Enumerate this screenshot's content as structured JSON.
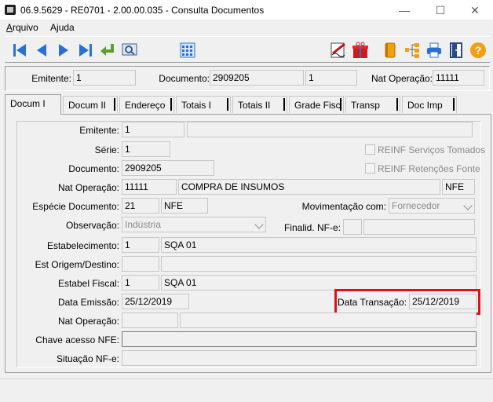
{
  "window": {
    "title": "06.9.5629 - RE0701 - 2.00.00.035 - Consulta Documentos",
    "minimize": "—",
    "maximize": "☐",
    "close": "✕"
  },
  "menu": {
    "arquivo": {
      "first": "A",
      "rest": "rquivo"
    },
    "ajuda": {
      "first": "A",
      "underline": "j",
      "rest": "uda"
    }
  },
  "toolbar": {
    "icons": [
      "first-record-icon",
      "previous-record-icon",
      "next-record-icon",
      "last-record-icon",
      "go-to-icon",
      "search-icon",
      "calendar-icon",
      "signature-icon",
      "gift-icon",
      "book-icon",
      "tree-icon",
      "print-icon",
      "exit-icon",
      "help-icon"
    ],
    "help_label": "?"
  },
  "header": {
    "emitente_label": "Emitente:",
    "emitente_value": "1",
    "documento_label": "Documento:",
    "documento_value": "2909205",
    "documento_serie": "1",
    "nat_operacao_label": "Nat Operação:",
    "nat_operacao_value": "11111"
  },
  "tabs": [
    "Docum I",
    "Docum II",
    "Endereço",
    "Totais I",
    "Totais II",
    "Grade Fisc",
    "Transp",
    "Doc Imp"
  ],
  "form": {
    "emitente": {
      "label": "Emitente:",
      "value": "1",
      "name": ""
    },
    "serie": {
      "label": "Série:",
      "value": "1"
    },
    "documento": {
      "label": "Documento:",
      "value": "2909205"
    },
    "nat_operacao": {
      "label": "Nat Operação:",
      "code": "11111",
      "desc": "COMPRA DE INSUMOS",
      "tipo": "NFE"
    },
    "especie": {
      "label": "Espécie Documento:",
      "code": "21",
      "desc": "NFE"
    },
    "movimentacao": {
      "label": "Movimentação com:",
      "value": "Fornecedor"
    },
    "observacao": {
      "label": "Observação:",
      "value": "Indústria"
    },
    "finalid": {
      "label": "Finalid. NF-e:",
      "code": "",
      "desc": ""
    },
    "reinf_servicos": {
      "label": "REINF Serviços Tomados",
      "checked": false
    },
    "reinf_retencoes": {
      "label": "REINF Retenções Fonte",
      "checked": false
    },
    "estabelecimento": {
      "label": "Estabelecimento:",
      "code": "1",
      "desc": "SQA 01"
    },
    "est_origem": {
      "label": "Est Origem/Destino:",
      "code": "",
      "desc": ""
    },
    "estabel_fiscal": {
      "label": "Estabel Fiscal:",
      "code": "1",
      "desc": "SQA 01"
    },
    "data_emissao": {
      "label": "Data Emissão:",
      "value": "25/12/2019"
    },
    "data_transacao": {
      "label": "Data Transação:",
      "value": "25/12/2019"
    },
    "nat_operacao2": {
      "label": "Nat Operação:",
      "code": "",
      "desc": ""
    },
    "chave_acesso": {
      "label": "Chave acesso NFE:",
      "value": ""
    },
    "situacao": {
      "label": "Situação NF-e:",
      "value": ""
    }
  },
  "colors": {
    "highlight": "#e0101a",
    "nav_blue": "#2a6fd6",
    "enter_green": "#5aa02c"
  }
}
